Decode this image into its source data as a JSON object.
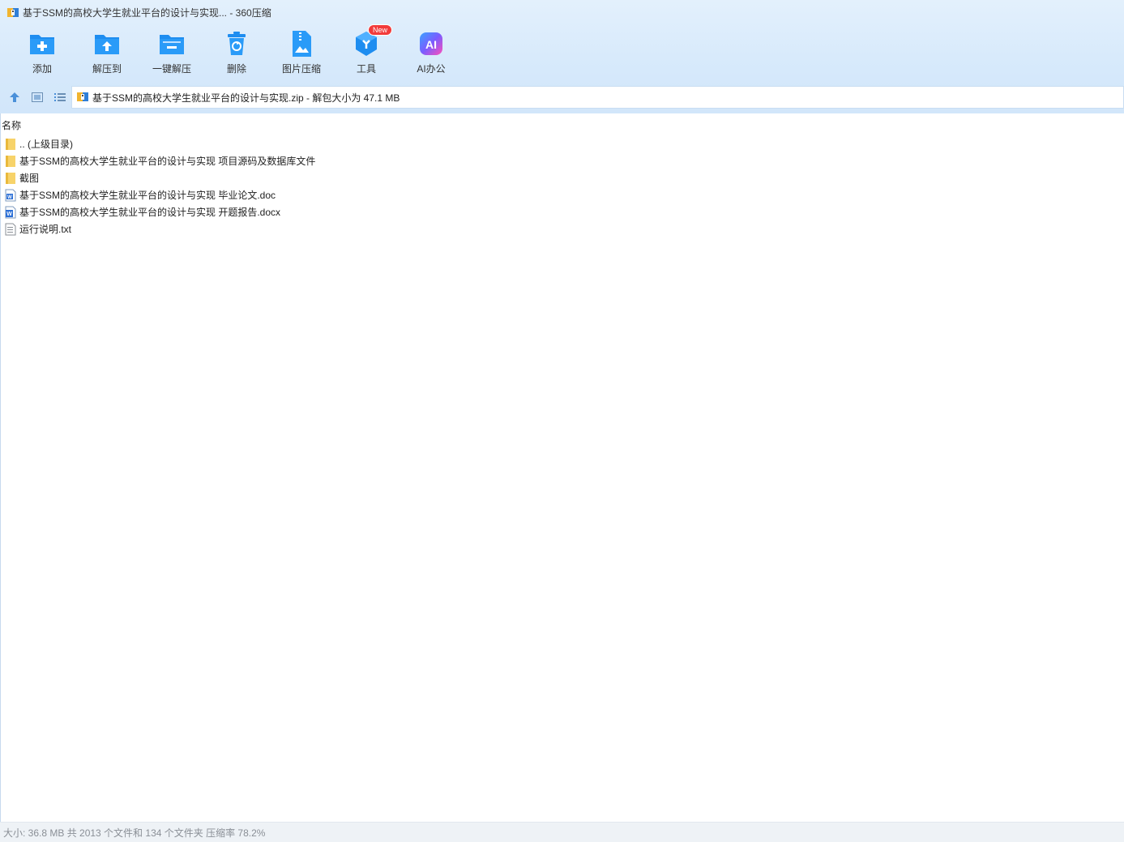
{
  "window": {
    "title": "基于SSM的高校大学生就业平台的设计与实现... - 360压缩"
  },
  "toolbar": {
    "buttons": [
      {
        "label": "添加",
        "icon": "add-folder-icon"
      },
      {
        "label": "解压到",
        "icon": "extract-to-icon"
      },
      {
        "label": "一键解压",
        "icon": "one-click-extract-icon"
      },
      {
        "label": "删除",
        "icon": "delete-icon"
      },
      {
        "label": "图片压缩",
        "icon": "image-compress-icon"
      },
      {
        "label": "工具",
        "icon": "tools-icon",
        "badge": "New"
      },
      {
        "label": "AI办公",
        "icon": "ai-office-icon"
      }
    ]
  },
  "path": {
    "text": "基于SSM的高校大学生就业平台的设计与实现.zip - 解包大小为 47.1 MB"
  },
  "list": {
    "column_name": "名称",
    "items": [
      {
        "name": ".. (上级目录)",
        "type": "folder"
      },
      {
        "name": "基于SSM的高校大学生就业平台的设计与实现 项目源码及数据库文件",
        "type": "folder"
      },
      {
        "name": "截图",
        "type": "folder"
      },
      {
        "name": "基于SSM的高校大学生就业平台的设计与实现 毕业论文.doc",
        "type": "doc"
      },
      {
        "name": "基于SSM的高校大学生就业平台的设计与实现 开题报告.docx",
        "type": "docx"
      },
      {
        "name": "运行说明.txt",
        "type": "txt"
      }
    ]
  },
  "status": {
    "text": "大小: 36.8 MB 共 2013 个文件和 134 个文件夹 压缩率 78.2%"
  },
  "colors": {
    "accent": "#1e8df0",
    "folder": "#f7d36a",
    "word": "#2b6fd6",
    "badge": "#f23b3b"
  }
}
